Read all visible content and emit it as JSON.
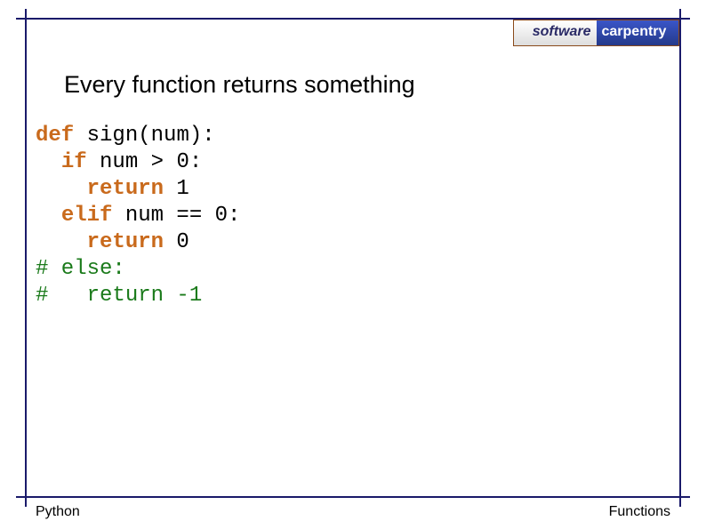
{
  "logo": {
    "left": "software",
    "right": "carpentry"
  },
  "heading": "Every function returns something",
  "code": {
    "l1": {
      "kw": "def",
      "rest": " sign(num):"
    },
    "l2": {
      "pad": "  ",
      "kw": "if",
      "rest": " num > 0:"
    },
    "l3": {
      "pad": "    ",
      "kw": "return",
      "rest": " 1"
    },
    "l4": {
      "pad": "  ",
      "kw": "elif",
      "rest": " num == 0:"
    },
    "l5": {
      "pad": "    ",
      "kw": "return",
      "rest": " 0"
    },
    "l6": "# else:",
    "l7": "#   return -1"
  },
  "footer": {
    "left": "Python",
    "right": "Functions"
  }
}
